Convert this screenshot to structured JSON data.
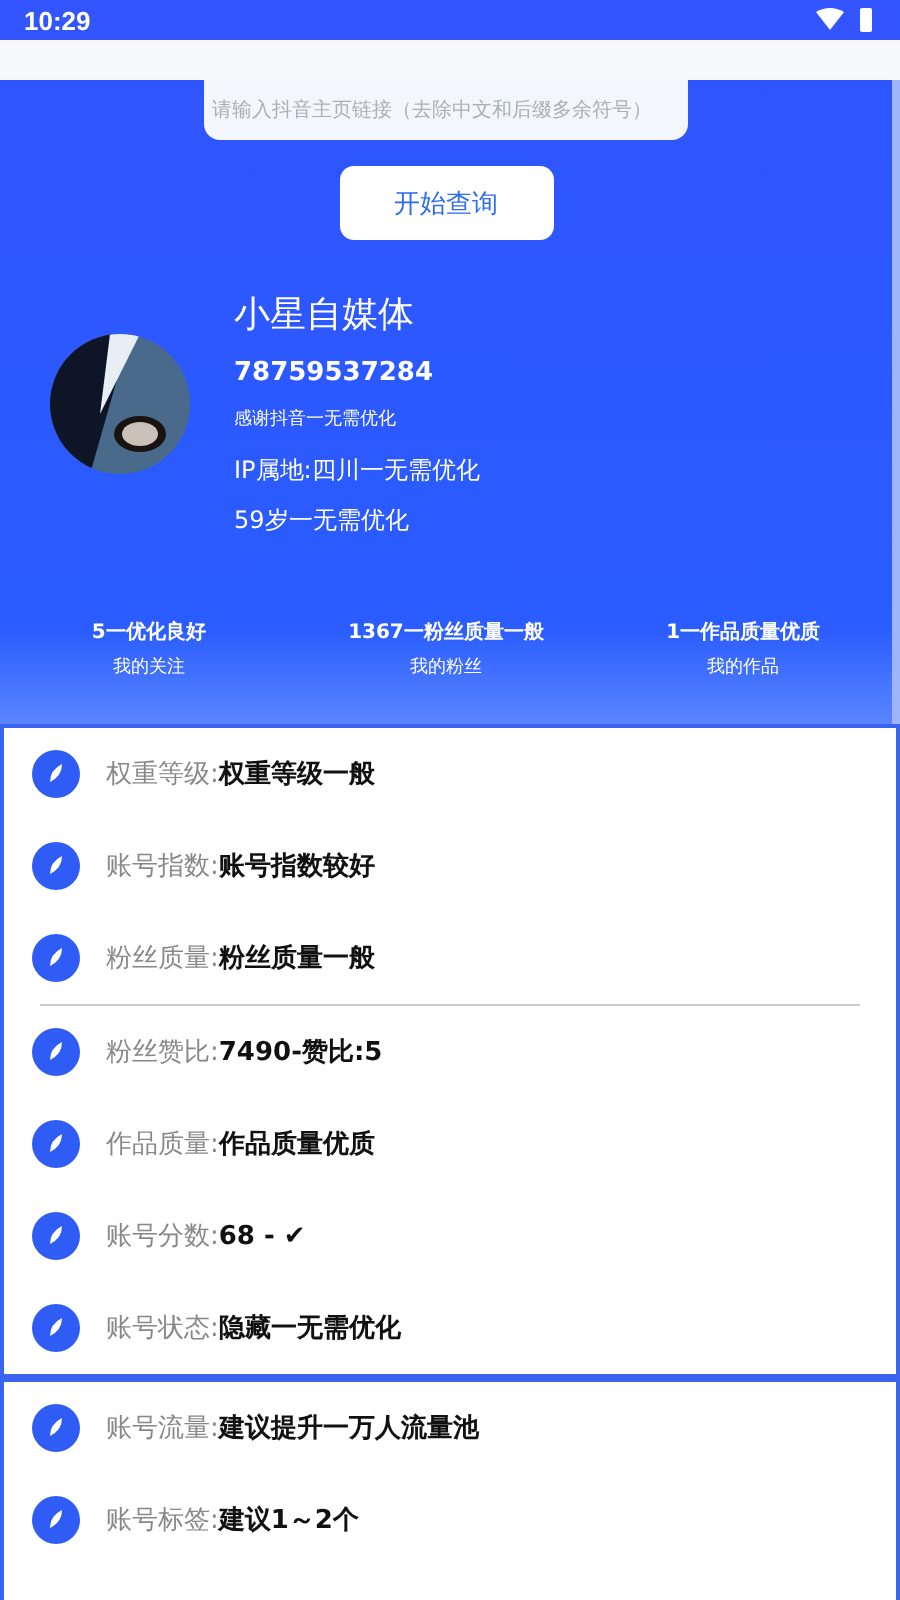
{
  "status_bar": {
    "time": "10:29"
  },
  "search": {
    "placeholder": "请输入抖音主页链接（去除中文和后缀多余符号）",
    "button": "开始查询"
  },
  "profile": {
    "name": "小星自媒体",
    "id": "78759537284",
    "signature": "感谢抖音一无需优化",
    "ip": "IP属地:四川一无需优化",
    "age": "59岁一无需优化"
  },
  "stats": [
    {
      "value": "5一优化良好",
      "label": "我的关注"
    },
    {
      "value": "1367一粉丝质量一般",
      "label": "我的粉丝"
    },
    {
      "value": "1一作品质量优质",
      "label": "我的作品"
    }
  ],
  "cards": [
    {
      "groups": [
        [
          {
            "label": "权重等级:",
            "value": "权重等级一般"
          },
          {
            "label": "账号指数:",
            "value": "账号指数较好"
          },
          {
            "label": "粉丝质量:",
            "value": "粉丝质量一般"
          }
        ],
        [
          {
            "label": "粉丝赞比:",
            "value": "7490-赞比:5"
          },
          {
            "label": "作品质量:",
            "value": "作品质量优质"
          },
          {
            "label": "账号分数:",
            "value": "68 - ✔"
          },
          {
            "label": "账号状态:",
            "value": "隐藏一无需优化"
          }
        ]
      ]
    },
    {
      "groups": [
        [
          {
            "label": "账号流量:",
            "value": "建议提升一万人流量池"
          },
          {
            "label": "账号标签:",
            "value": "建议1～2个"
          }
        ]
      ]
    }
  ]
}
